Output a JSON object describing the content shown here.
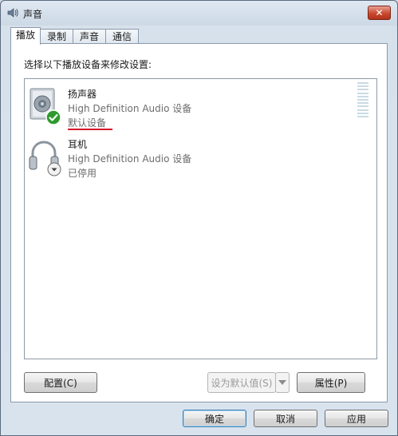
{
  "window": {
    "title": "声音",
    "close_symbol": "✕"
  },
  "tabs": [
    {
      "label": "播放"
    },
    {
      "label": "录制"
    },
    {
      "label": "声音"
    },
    {
      "label": "通信"
    }
  ],
  "panel": {
    "prompt": "选择以下播放设备来修改设置:",
    "devices": [
      {
        "name": "扬声器",
        "driver": "High Definition Audio 设备",
        "status": "默认设备",
        "icon": "speaker-icon",
        "badge": "checkmark-badge-icon"
      },
      {
        "name": "耳机",
        "driver": "High Definition Audio 设备",
        "status": "已停用",
        "icon": "headphones-icon",
        "badge": "down-arrow-badge-icon"
      }
    ]
  },
  "buttons": {
    "configure": "配置(C)",
    "set_default": "设为默认值(S)",
    "properties": "属性(P)",
    "ok": "确定",
    "cancel": "取消",
    "apply": "应用"
  },
  "colors": {
    "default_status_underline": "#d6172b",
    "check_badge": "#2e9a2e",
    "close_button": "#c94a2f"
  }
}
